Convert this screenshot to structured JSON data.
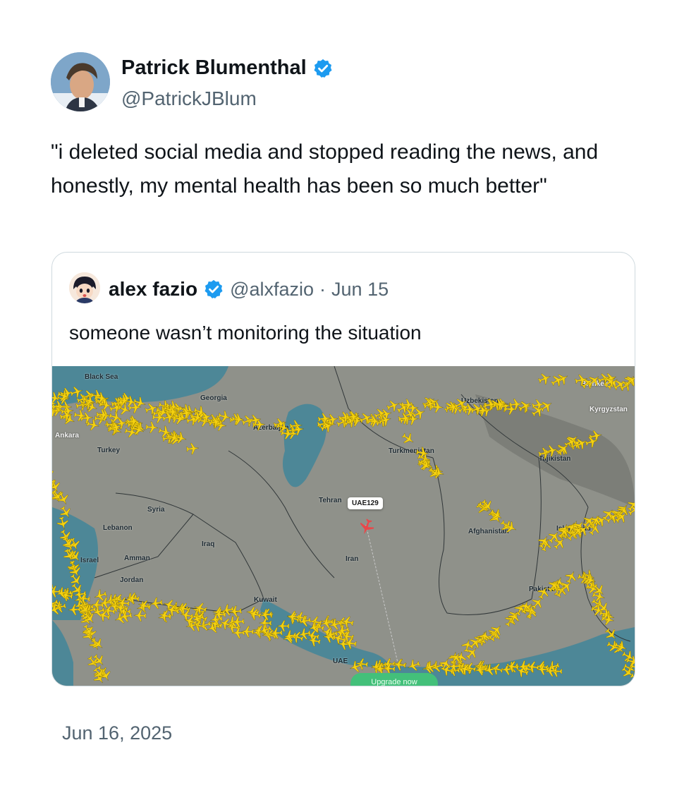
{
  "tweet": {
    "author": {
      "name": "Patrick Blumenthal",
      "handle": "@PatrickJBlum",
      "verified_icon": "verified-badge-icon",
      "verified_color": "#1d9bf0"
    },
    "text": "\"i deleted social media and stopped reading the news, and honestly, my mental health has been so much better\"",
    "timestamp": "Jun 16, 2025"
  },
  "quoted_tweet": {
    "author": {
      "name": "alex fazio",
      "handle": "@alxfazio",
      "verified_icon": "verified-badge-icon"
    },
    "separator": "·",
    "date": "Jun 15",
    "text": "someone wasn’t monitoring the situation",
    "map": {
      "labels": {
        "black_sea": "Black Sea",
        "georgia": "Georgia",
        "azerbaijan": "Azerbaijan",
        "ankara": "Ankara",
        "turkey": "Turkey",
        "syria": "Syria",
        "lebanon": "Lebanon",
        "israel": "Israel",
        "amman": "Amman",
        "jordan": "Jordan",
        "iraq": "Iraq",
        "kuwait": "Kuwait",
        "tehran": "Tehran",
        "iran": "Iran",
        "turkmenistan": "Turkmenistan",
        "uzbekistan": "Uzbekistan",
        "tajikistan": "Tajikistan",
        "kyrgyzstan": "Kyrgyzstan",
        "bishkek": "Bishkek",
        "afghanistan": "Afghanistan",
        "islamabad": "Islamabad",
        "pakistan": "Pakistan",
        "uae": "UAE"
      },
      "highlighted_flight": "UAE129",
      "upgrade_button": "Upgrade now",
      "colors": {
        "aircraft": "#f5d10f",
        "highlighted_aircraft": "#e8474a",
        "water": "#4f8a9e",
        "land": "#8d8f88"
      }
    }
  }
}
